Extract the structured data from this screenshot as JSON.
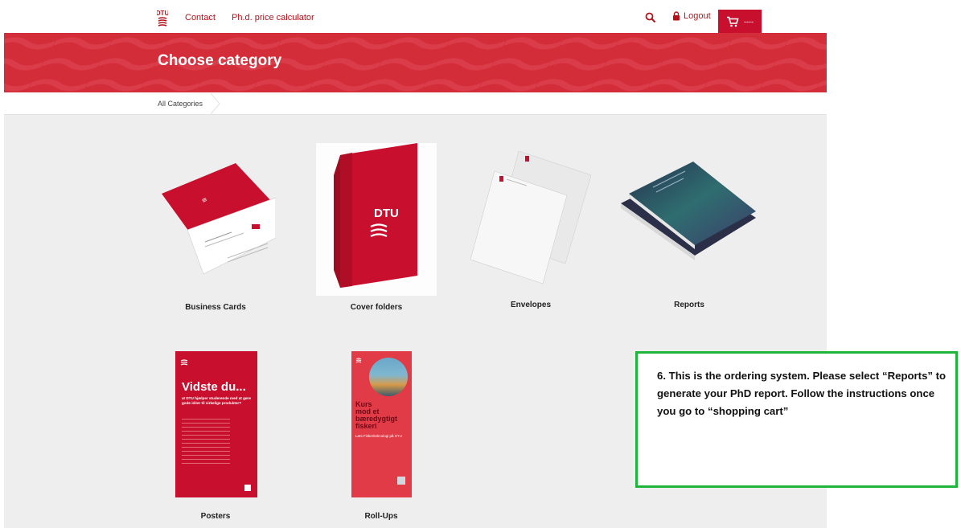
{
  "nav": {
    "logo_text": "DTU",
    "links": [
      {
        "label": "Contact"
      },
      {
        "label": "Ph.d. price calculator"
      }
    ],
    "search_icon": "search-icon",
    "logout_label": "Logout",
    "cart_icon": "cart-icon",
    "cart_count": "----"
  },
  "banner": {
    "title": "Choose category"
  },
  "breadcrumb": {
    "items": [
      "All Categories"
    ]
  },
  "categories": [
    {
      "label": "Business Cards"
    },
    {
      "label": "Cover folders",
      "folder_logo": "DTU"
    },
    {
      "label": "Envelopes"
    },
    {
      "label": "Reports"
    },
    {
      "label": "Posters",
      "poster_title": "Vidste du...",
      "poster_subtitle": "at DTU hjælper studerende med at gøre gode idéer til virkelige produkter?"
    },
    {
      "label": "Roll-Ups",
      "rollup_title_1": "Kurs",
      "rollup_title_2": "mod et",
      "rollup_title_3": "bæredygtigt",
      "rollup_title_4": "fiskeri",
      "rollup_sub": "Læs Fiskeriteknologi på DTU"
    }
  ],
  "callout": {
    "text": "6. This is the ordering system. Please select “Reports” to generate your PhD report. Follow the instructions once you go to “shopping cart”"
  },
  "colors": {
    "brand_red": "#c8102e",
    "banner_red": "#d32d3a",
    "callout_border": "#1fb53a",
    "content_bg": "#eeeeee"
  }
}
